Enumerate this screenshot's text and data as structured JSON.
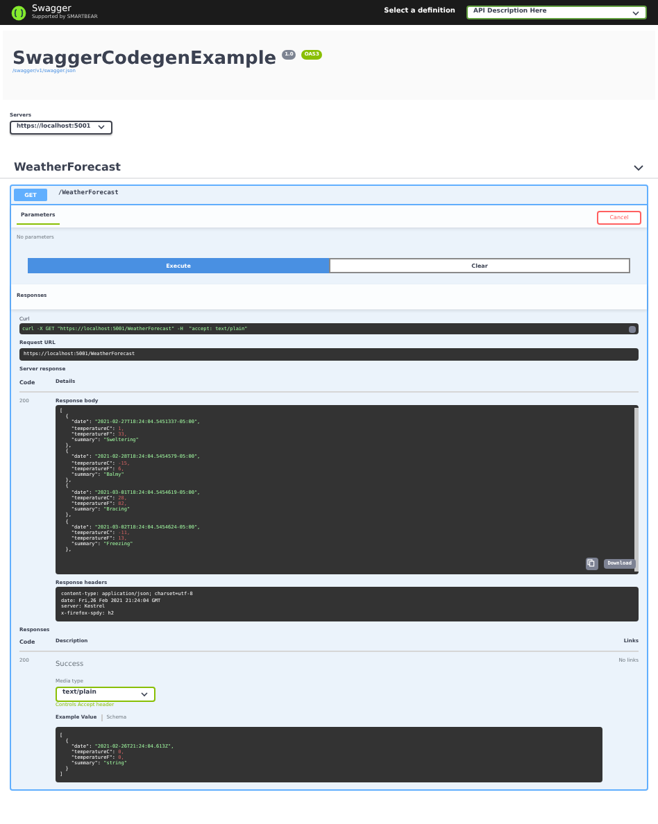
{
  "topbar": {
    "logo_text": "Swagger",
    "logo_subtext": "Supported by SMARTBEAR",
    "definition_label": "Select a definition",
    "definition_value": "API Description Here"
  },
  "info": {
    "title": "SwaggerCodegenExample",
    "version": "1.0",
    "oas": "OAS3",
    "url": "/swagger/v1/swagger.json"
  },
  "servers": {
    "label": "Servers",
    "value": "https://localhost:5001"
  },
  "tag": {
    "name": "WeatherForecast",
    "expanded": true
  },
  "operation": {
    "method": "GET",
    "path": "/WeatherForecast",
    "parameters_tab": "Parameters",
    "cancel": "Cancel",
    "no_parameters": "No parameters",
    "execute": "Execute",
    "clear": "Clear",
    "responses_heading": "Responses",
    "curl_label": "Curl",
    "curl": "curl -X GET \"https://localhost:5001/WeatherForecast\" -H  \"accept: text/plain\"",
    "request_url_label": "Request URL",
    "request_url": "https://localhost:5001/WeatherForecast",
    "server_response_label": "Server response",
    "code_header": "Code",
    "details_header": "Details",
    "code": "200",
    "response_body_label": "Response body",
    "response_body": [
      {
        "text": "["
      },
      {
        "text": "  {"
      },
      {
        "text": "    \"date\": ",
        "value": "\"2021-02-27T18:24:04.5451337-05:00\",",
        "kind": "string"
      },
      {
        "text": "    \"temperatureC\": ",
        "value": "1,",
        "kind": "number"
      },
      {
        "text": "    \"temperatureF\": ",
        "value": "33,",
        "kind": "number"
      },
      {
        "text": "    \"summary\": ",
        "value": "\"Sweltering\"",
        "kind": "string"
      },
      {
        "text": "  },"
      },
      {
        "text": "  {"
      },
      {
        "text": "    \"date\": ",
        "value": "\"2021-02-28T18:24:04.5454579-05:00\",",
        "kind": "string"
      },
      {
        "text": "    \"temperatureC\": ",
        "value": "-15,",
        "kind": "number"
      },
      {
        "text": "    \"temperatureF\": ",
        "value": "6,",
        "kind": "number"
      },
      {
        "text": "    \"summary\": ",
        "value": "\"Balmy\"",
        "kind": "string"
      },
      {
        "text": "  },"
      },
      {
        "text": "  {"
      },
      {
        "text": "    \"date\": ",
        "value": "\"2021-03-01T18:24:04.5454619-05:00\",",
        "kind": "string"
      },
      {
        "text": "    \"temperatureC\": ",
        "value": "28,",
        "kind": "number"
      },
      {
        "text": "    \"temperatureF\": ",
        "value": "82,",
        "kind": "number"
      },
      {
        "text": "    \"summary\": ",
        "value": "\"Bracing\"",
        "kind": "string"
      },
      {
        "text": "  },"
      },
      {
        "text": "  {"
      },
      {
        "text": "    \"date\": ",
        "value": "\"2021-03-02T18:24:04.5454624-05:00\",",
        "kind": "string"
      },
      {
        "text": "    \"temperatureC\": ",
        "value": "-11,",
        "kind": "number"
      },
      {
        "text": "    \"temperatureF\": ",
        "value": "13,",
        "kind": "number"
      },
      {
        "text": "    \"summary\": ",
        "value": "\"Freezing\"",
        "kind": "string"
      },
      {
        "text": "  },"
      }
    ],
    "download": "Download",
    "response_headers_label": "Response headers",
    "response_headers": [
      "content-type: application/json; charset=utf-8",
      "date: Fri,26 Feb 2021 21:24:04 GMT",
      "server: Kestrel",
      "x-firefox-spdy: h2"
    ],
    "responses": {
      "label": "Responses",
      "code_header": "Code",
      "description_header": "Description",
      "links_header": "Links",
      "code": "200",
      "description": "Success",
      "links": "No links",
      "media_type_label": "Media type",
      "media_type": "text/plain",
      "media_hint": "Controls Accept header",
      "tabs": [
        {
          "label": "Example Value",
          "selected": true
        },
        {
          "label": "Schema",
          "selected": false
        }
      ],
      "example": [
        {
          "text": "["
        },
        {
          "text": "  {"
        },
        {
          "text": "    \"date\": ",
          "value": "\"2021-02-26T21:24:04.613Z\",",
          "kind": "string"
        },
        {
          "text": "    \"temperatureC\": ",
          "value": "0,",
          "kind": "number"
        },
        {
          "text": "    \"temperatureF\": ",
          "value": "0,",
          "kind": "number"
        },
        {
          "text": "    \"summary\": ",
          "value": "\"string\"",
          "kind": "string"
        },
        {
          "text": "  }"
        },
        {
          "text": "]"
        }
      ]
    }
  }
}
